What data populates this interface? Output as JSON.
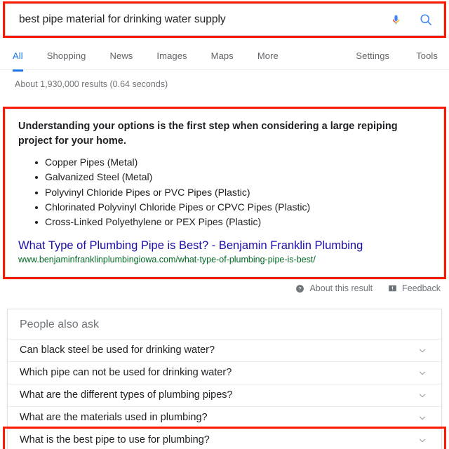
{
  "search": {
    "query": "best pipe material for drinking water supply",
    "placeholder": "Search",
    "mic_icon": "microphone-icon",
    "search_icon": "search-icon"
  },
  "nav": {
    "left_items": [
      {
        "label": "All",
        "active": true
      },
      {
        "label": "Shopping",
        "active": false
      },
      {
        "label": "News",
        "active": false
      },
      {
        "label": "Images",
        "active": false
      },
      {
        "label": "Maps",
        "active": false
      },
      {
        "label": "More",
        "active": false
      }
    ],
    "right_items": [
      {
        "label": "Settings"
      },
      {
        "label": "Tools"
      }
    ]
  },
  "result_stats": "About 1,930,000 results (0.64 seconds)",
  "featured_snippet": {
    "heading": "Understanding your options is the first step when considering a large repiping project for your home.",
    "bullets": [
      "Copper Pipes (Metal)",
      "Galvanized Steel (Metal)",
      "Polyvinyl Chloride Pipes or PVC Pipes (Plastic)",
      "Chlorinated Polyvinyl Chloride Pipes or CPVC Pipes (Plastic)",
      "Cross-Linked Polyethylene or PEX Pipes (Plastic)"
    ],
    "link_title": "What Type of Plumbing Pipe is Best? - Benjamin Franklin Plumbing",
    "link_url": "www.benjaminfranklinplumbingiowa.com/what-type-of-plumbing-pipe-is-best/"
  },
  "meta_row": {
    "about_label": "About this result",
    "about_icon": "question-circle-icon",
    "feedback_label": "Feedback",
    "feedback_icon": "feedback-flag-icon"
  },
  "people_also_ask": {
    "title": "People also ask",
    "questions": [
      {
        "text": "Can black steel be used for drinking water?",
        "highlighted": false
      },
      {
        "text": "Which pipe can not be used for drinking water?",
        "highlighted": false
      },
      {
        "text": "What are the different types of plumbing pipes?",
        "highlighted": false
      },
      {
        "text": "What are the materials used in plumbing?",
        "highlighted": false
      },
      {
        "text": "What is the best pipe to use for plumbing?",
        "highlighted": true
      }
    ],
    "chevron_icon": "chevron-down-icon"
  },
  "colors": {
    "highlight_box": "#ff1a00",
    "link_blue": "#1a0dab",
    "url_green": "#006621",
    "tab_active_blue": "#1a73e8",
    "text_gray": "#70757a"
  }
}
